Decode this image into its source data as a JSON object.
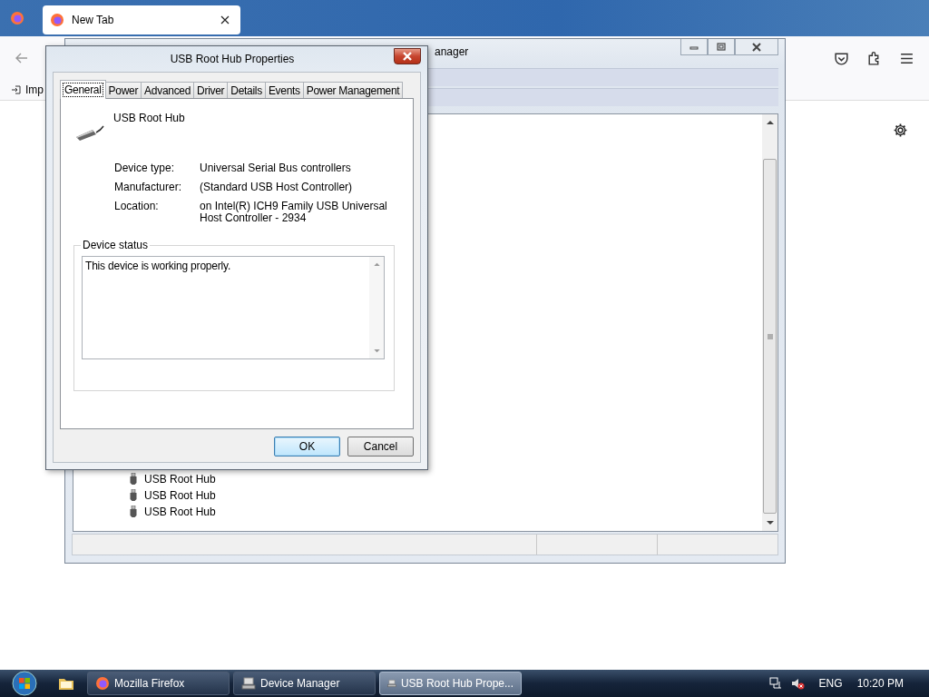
{
  "firefox": {
    "tab": {
      "title": "New Tab"
    },
    "bookmarks": [
      {
        "label": "Imp"
      }
    ]
  },
  "device_manager": {
    "title_fragment": "anager",
    "tree_items": [
      {
        "label": "USB Root Hub"
      },
      {
        "label": "USB Root Hub"
      },
      {
        "label": "USB Root Hub"
      }
    ]
  },
  "dialog": {
    "title": "USB Root Hub Properties",
    "tabs": [
      {
        "label": "General",
        "selected": true
      },
      {
        "label": "Power",
        "selected": false
      },
      {
        "label": "Advanced",
        "selected": false
      },
      {
        "label": "Driver",
        "selected": false
      },
      {
        "label": "Details",
        "selected": false
      },
      {
        "label": "Events",
        "selected": false
      },
      {
        "label": "Power Management",
        "selected": false
      }
    ],
    "device_name": "USB Root Hub",
    "properties": [
      {
        "label": "Device type:",
        "value": "Universal Serial Bus controllers"
      },
      {
        "label": "Manufacturer:",
        "value": "(Standard USB Host Controller)"
      },
      {
        "label": "Location:",
        "value": "on Intel(R) ICH9 Family USB Universal Host Controller - 2934"
      }
    ],
    "status_group": {
      "legend": "Device status",
      "text": "This device is working properly."
    },
    "buttons": [
      {
        "label": "OK",
        "default": true
      },
      {
        "label": "Cancel",
        "default": false
      }
    ]
  },
  "taskbar": {
    "items": [
      {
        "label": "Mozilla Firefox",
        "kind": "firefox",
        "selected": false
      },
      {
        "label": "Device Manager",
        "kind": "devmgr",
        "selected": false
      },
      {
        "label": "USB Root Hub Prope...",
        "kind": "devmgr",
        "selected": true
      }
    ],
    "tray": {
      "language": "ENG",
      "time": "10:20 PM"
    }
  }
}
